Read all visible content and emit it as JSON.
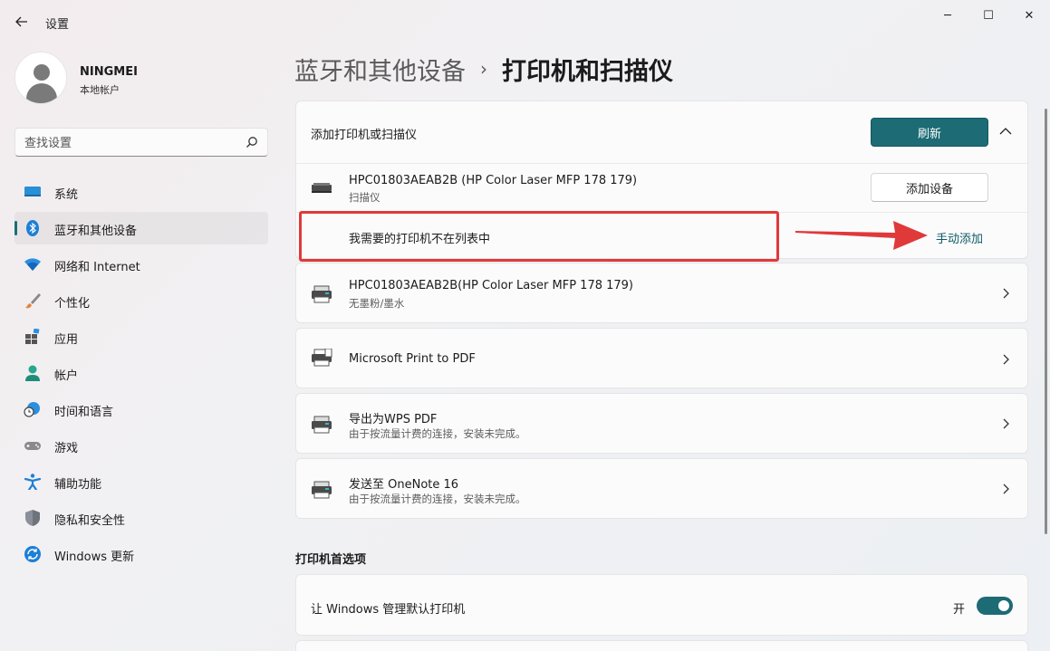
{
  "window": {
    "title": "设置",
    "back_icon": "back-arrow-icon",
    "minimize_glyph": "─",
    "maximize_glyph": "☐",
    "close_glyph": "✕"
  },
  "user": {
    "name": "NINGMEI",
    "account_type": "本地帐户"
  },
  "search": {
    "placeholder": "查找设置"
  },
  "sidebar": {
    "items": [
      {
        "label": "系统",
        "icon": "system-icon",
        "active": false
      },
      {
        "label": "蓝牙和其他设备",
        "icon": "bluetooth-icon",
        "active": true
      },
      {
        "label": "网络和 Internet",
        "icon": "wifi-icon",
        "active": false
      },
      {
        "label": "个性化",
        "icon": "brush-icon",
        "active": false
      },
      {
        "label": "应用",
        "icon": "apps-icon",
        "active": false
      },
      {
        "label": "帐户",
        "icon": "account-icon",
        "active": false
      },
      {
        "label": "时间和语言",
        "icon": "globe-clock-icon",
        "active": false
      },
      {
        "label": "游戏",
        "icon": "gamepad-icon",
        "active": false
      },
      {
        "label": "辅助功能",
        "icon": "accessibility-icon",
        "active": false
      },
      {
        "label": "隐私和安全性",
        "icon": "shield-icon",
        "active": false
      },
      {
        "label": "Windows 更新",
        "icon": "update-icon",
        "active": false
      }
    ]
  },
  "breadcrumb": {
    "parent": "蓝牙和其他设备",
    "separator": "›",
    "current": "打印机和扫描仪"
  },
  "add_section": {
    "title": "添加打印机或扫描仪",
    "refresh_label": "刷新",
    "found_device_name": "HPC01803AEAB2B (HP Color Laser MFP 178 179)",
    "found_device_type": "扫描仪",
    "add_device_label": "添加设备",
    "not_listed_text": "我需要的打印机不在列表中",
    "manual_add_label": "手动添加"
  },
  "printers": [
    {
      "name": "HPC01803AEAB2B(HP Color Laser MFP 178 179)",
      "status": "无墨粉/墨水"
    },
    {
      "name": "Microsoft Print to PDF",
      "status": ""
    },
    {
      "name": "导出为WPS PDF",
      "status": "由于按流量计费的连接，安装未完成。"
    },
    {
      "name": "发送至 OneNote 16",
      "status": "由于按流量计费的连接，安装未完成。"
    }
  ],
  "preferences": {
    "title": "打印机首选项",
    "default_printer_label": "让 Windows 管理默认打印机",
    "toggle_state": "开",
    "toggle_on": true
  },
  "colors": {
    "accent": "#1c6b75",
    "highlight": "#e0393a",
    "link": "#0e5a65"
  }
}
